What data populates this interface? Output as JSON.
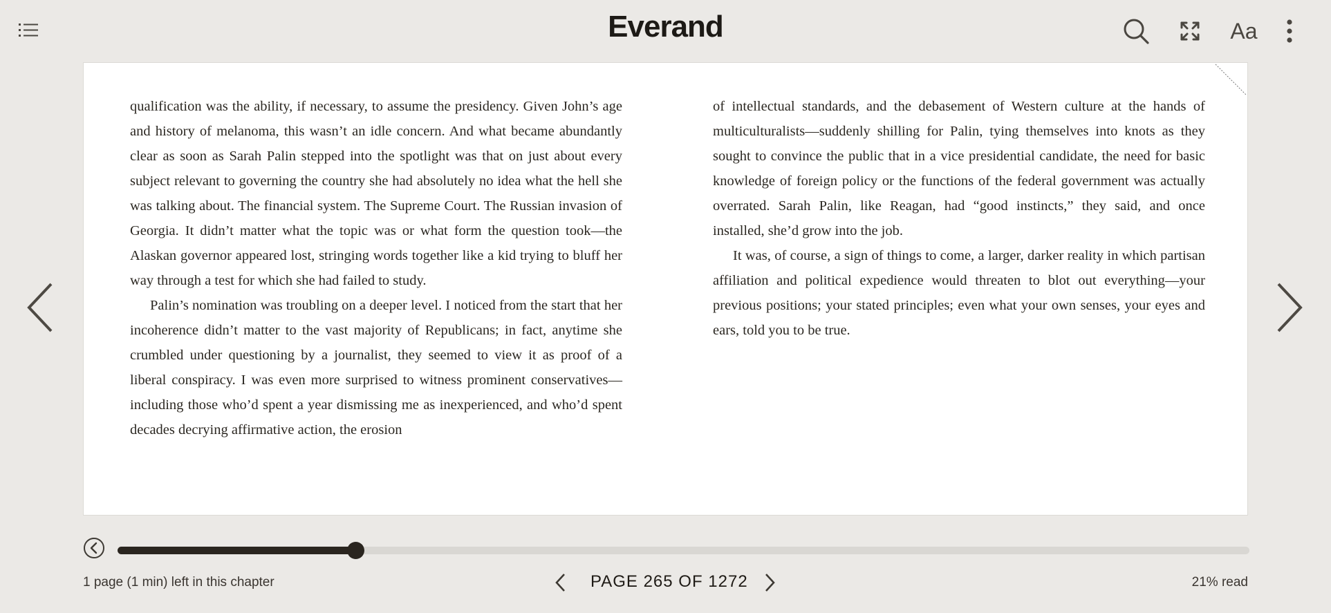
{
  "header": {
    "logo": "Everand",
    "icons": [
      "table-of-contents-icon",
      "search-icon",
      "fullscreen-icon",
      "text-settings-icon",
      "more-options-icon"
    ],
    "text_settings_label": "Aa"
  },
  "reader": {
    "left_column": [
      {
        "indent": false,
        "text": "qualification was the ability, if necessary, to assume the presidency. Given John’s age and history of melanoma, this wasn’t an idle concern. And what became abundantly clear as soon as Sarah Palin stepped into the spotlight was that on just about every subject relevant to governing the country she had absolutely no idea what the hell she was talking about. The financial system. The Supreme Court. The Russian invasion of Georgia. It didn’t matter what the topic was or what form the question took—the Alaskan governor appeared lost, stringing words together like a kid trying to bluff her way through a test for which she had failed to study."
      },
      {
        "indent": true,
        "text": "Palin’s nomination was troubling on a deeper level. I noticed from the start that her incoherence didn’t matter to the vast majority of Republicans; in fact, anytime she crumbled under questioning by a journalist, they seemed to view it as proof of a liberal conspiracy. I was even more surprised to witness prominent conservatives—including those who’d spent a year dismissing me as inexperienced, and who’d spent decades decrying affirmative action, the erosion"
      }
    ],
    "right_column": [
      {
        "indent": false,
        "text": "of intellectual standards, and the debasement of Western culture at the hands of multiculturalists—suddenly shilling for Palin, tying themselves into knots as they sought to convince the public that in a vice presidential candidate, the need for basic knowledge of foreign policy or the functions of the federal government was actually overrated. Sarah Palin, like Reagan, had “good instincts,” they said, and once installed, she’d grow into the job."
      },
      {
        "indent": true,
        "text": "It was, of course, a sign of things to come, a larger, darker reality in which partisan affiliation and political expedience would threaten to blot out everything—your previous positions; your stated principles; even what your own senses, your eyes and ears, told you to be true."
      }
    ]
  },
  "navigation": {
    "prev_icon": "chevron-left-icon",
    "next_icon": "chevron-right-icon"
  },
  "footer": {
    "chapter_remaining": "1 page (1 min) left in this chapter",
    "page_indicator": "PAGE 265 OF 1272",
    "percent_read": "21% read",
    "progress_fraction": 0.21,
    "back_icon": "back-circle-icon"
  }
}
